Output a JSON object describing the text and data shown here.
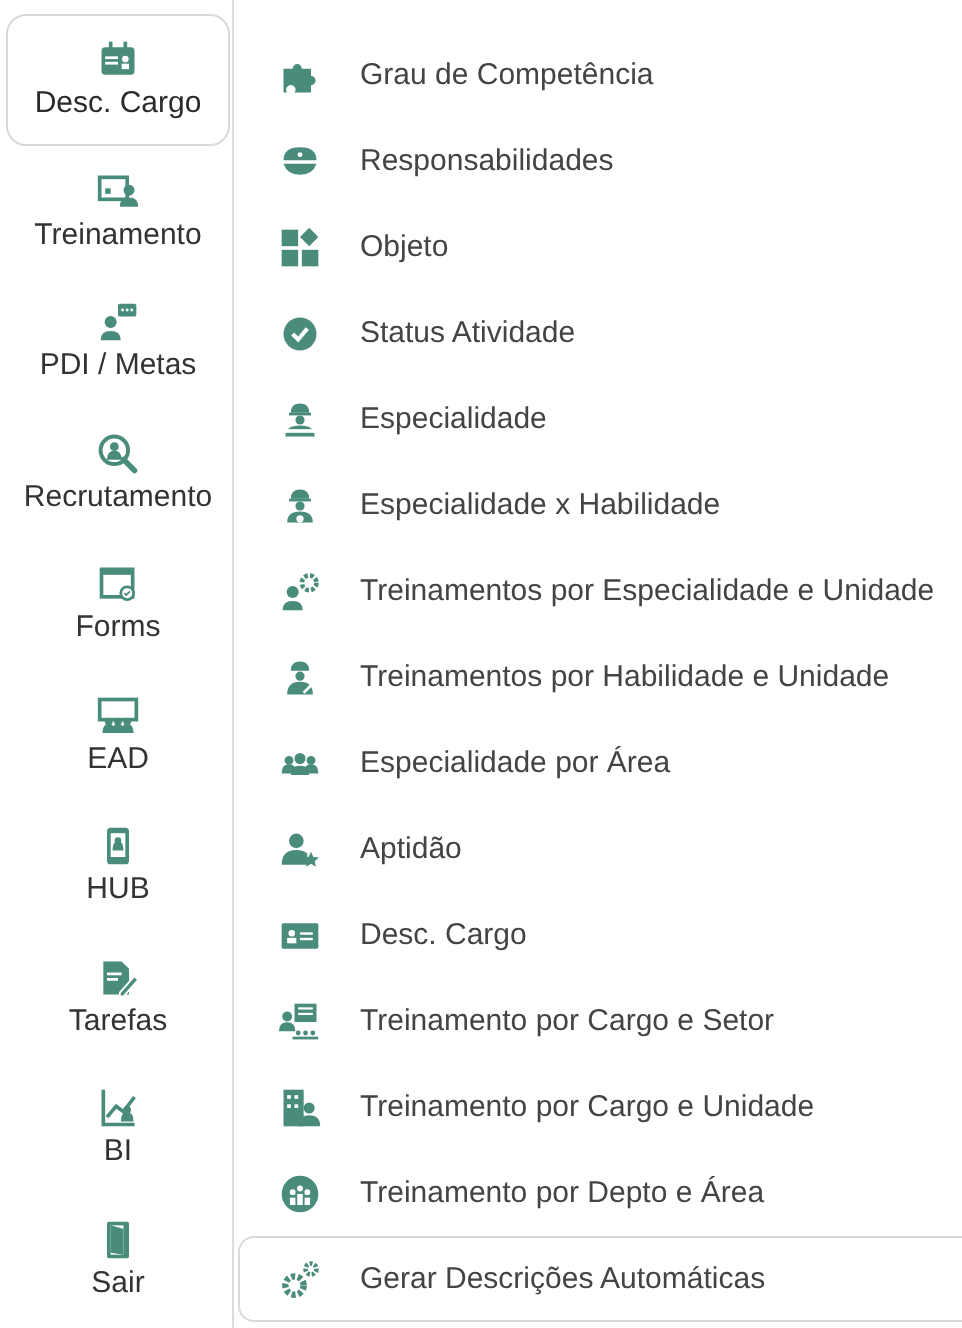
{
  "sidebar": {
    "items": [
      {
        "label": "Desc. Cargo",
        "selected": true
      },
      {
        "label": "Treinamento",
        "selected": false
      },
      {
        "label": "PDI / Metas",
        "selected": false
      },
      {
        "label": "Recrutamento",
        "selected": false
      },
      {
        "label": "Forms",
        "selected": false
      },
      {
        "label": "EAD",
        "selected": false
      },
      {
        "label": "HUB",
        "selected": false
      },
      {
        "label": "Tarefas",
        "selected": false
      },
      {
        "label": "BI",
        "selected": false
      },
      {
        "label": "Sair",
        "selected": false
      }
    ]
  },
  "menu": {
    "items": [
      {
        "label": "Grau de Competência",
        "selected": false
      },
      {
        "label": "Responsabilidades",
        "selected": false
      },
      {
        "label": "Objeto",
        "selected": false
      },
      {
        "label": "Status Atividade",
        "selected": false
      },
      {
        "label": "Especialidade",
        "selected": false
      },
      {
        "label": "Especialidade x Habilidade",
        "selected": false
      },
      {
        "label": "Treinamentos por Especialidade e Unidade",
        "selected": false
      },
      {
        "label": "Treinamentos por Habilidade e Unidade",
        "selected": false
      },
      {
        "label": "Especialidade por Área",
        "selected": false
      },
      {
        "label": "Aptidão",
        "selected": false
      },
      {
        "label": "Desc. Cargo",
        "selected": false
      },
      {
        "label": "Treinamento por Cargo e Setor",
        "selected": false
      },
      {
        "label": "Treinamento por Cargo e Unidade",
        "selected": false
      },
      {
        "label": "Treinamento por Depto e Área",
        "selected": false
      },
      {
        "label": "Gerar Descrições Automáticas",
        "selected": true
      }
    ]
  }
}
